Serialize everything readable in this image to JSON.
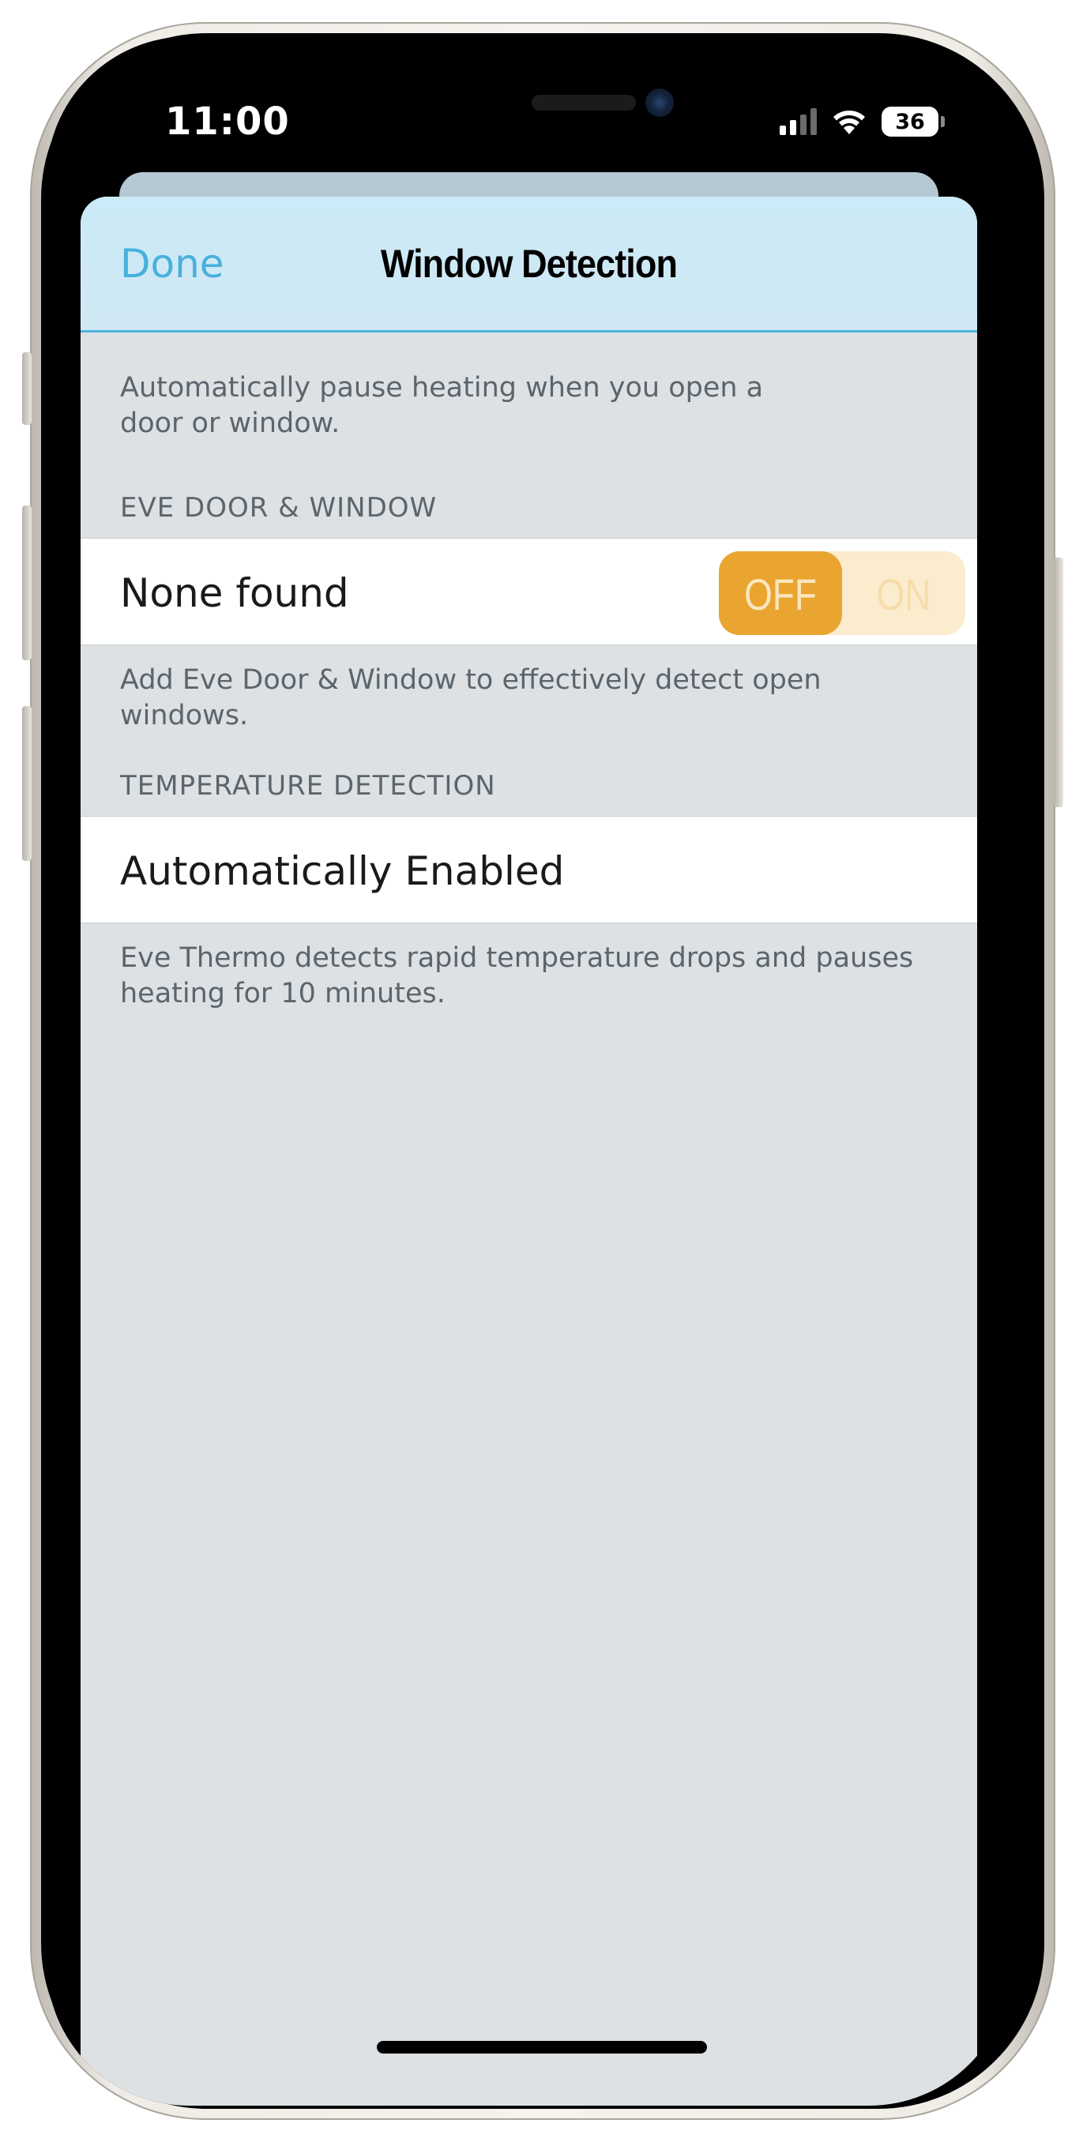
{
  "status_bar": {
    "time": "11:00",
    "battery": "36"
  },
  "nav": {
    "done_label": "Done",
    "title": "Window Detection"
  },
  "intro": {
    "text": "Automatically pause heating when you open a door or window."
  },
  "door_window_section": {
    "header": "EVE DOOR & WINDOW",
    "cell_label": "None found",
    "toggle": {
      "off_label": "OFF",
      "on_label": "ON",
      "state": "OFF"
    },
    "footer": "Add Eve Door & Window to effectively detect open windows."
  },
  "temperature_section": {
    "header": "TEMPERATURE DETECTION",
    "cell_label": "Automatically Enabled",
    "footer": "Eve Thermo detects rapid temperature drops and pauses heating for 10 minutes."
  },
  "colors": {
    "accent": "#48b0dc",
    "toggle_active": "#e9a530",
    "toggle_track": "#fbecce",
    "background": "#dde1e4"
  }
}
